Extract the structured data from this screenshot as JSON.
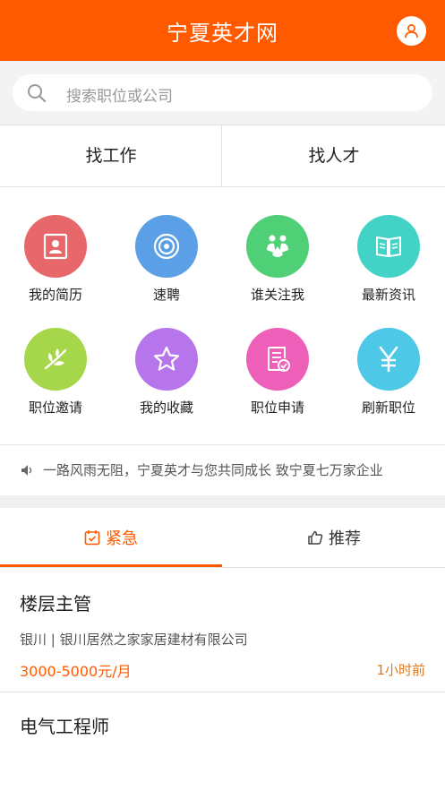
{
  "header": {
    "title": "宁夏英才网",
    "profile_icon": "user-icon",
    "color": "#ff5a00"
  },
  "search": {
    "placeholder": "搜索职位或公司",
    "icon": "search-icon"
  },
  "top_tabs": [
    {
      "label": "找工作"
    },
    {
      "label": "找人才"
    }
  ],
  "grid": [
    {
      "label": "我的简历",
      "icon": "resume-icon",
      "color": "#e8676a"
    },
    {
      "label": "速聘",
      "icon": "target-icon",
      "color": "#5b9fe6"
    },
    {
      "label": "谁关注我",
      "icon": "followers-icon",
      "color": "#4fd077"
    },
    {
      "label": "最新资讯",
      "icon": "news-icon",
      "color": "#43d3c6"
    },
    {
      "label": "职位邀请",
      "icon": "leaf-icon",
      "color": "#a6d64a"
    },
    {
      "label": "我的收藏",
      "icon": "star-icon",
      "color": "#b675ea"
    },
    {
      "label": "职位申请",
      "icon": "application-icon",
      "color": "#ee5fb9"
    },
    {
      "label": "刷新职位",
      "icon": "yen-icon",
      "color": "#4dc8e6"
    }
  ],
  "notice": {
    "text": "一路风雨无阻，宁夏英才与您共同成长 致宁夏七万家企业",
    "icon": "speaker-icon"
  },
  "job_tabs": [
    {
      "label": "紧急",
      "icon": "calendar-check-icon",
      "active": true
    },
    {
      "label": "推荐",
      "icon": "thumbs-up-icon",
      "active": false
    }
  ],
  "jobs": [
    {
      "title": "楼层主管",
      "company": "银川 | 银川居然之家家居建材有限公司",
      "salary": "3000-5000元/月",
      "time": "1小时前"
    },
    {
      "title": "电气工程师"
    }
  ]
}
